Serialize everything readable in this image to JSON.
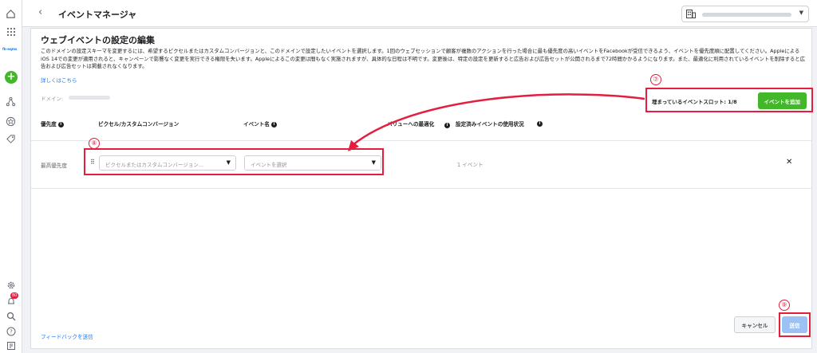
{
  "app": {
    "brand": "fb-eqms"
  },
  "header": {
    "title": "イベントマネージャ",
    "account_name": "",
    "notifications_badge": "80"
  },
  "page": {
    "title": "ウェブイベントの設定の編集",
    "description": "このドメインの設定スキーマを変更するには、希望するピクセルまたはカスタムコンバージョンと、このドメインで設定したいイベントを選択します。1回のウェブセッションで顧客が複数のアクションを行った場合に最も優先度の高いイベントをFacebookが受信できるよう、イベントを優先度順に配置してください。AppleによるiOS 14での変更が適用されると、キャンペーンで影響なく変更を実行できる権限を失います。Appleによるこの変更は間もなく実施されますが、具体的な日程は不明です。変更後は、特定の設定を更新すると広告および広告セットが公開されるまで72時間かかるようになります。また、最適化に利用されているイベントを削除すると広告および広告セットは掲載されなくなります。",
    "learn_more": "詳しくはこちら",
    "domain_label": "ドメイン:",
    "slots_text": "埋まっているイベントスロット: 1/8",
    "add_event_button": "イベントを追加",
    "annotations": {
      "n7": "⑦",
      "n8": "⑧",
      "n9": "⑨"
    }
  },
  "table": {
    "headers": {
      "priority": "優先度",
      "pixel": "ピクセル/カスタムコンバージョン",
      "event_name": "イベント名",
      "value_opt": "バリューへの最適化",
      "usage": "設定済みイベントの使用状況"
    },
    "rows": [
      {
        "priority": "最高優先度",
        "pixel_placeholder": "ピクセルまたはカスタムコンバージョン...",
        "event_placeholder": "イベントを選択",
        "usage": "1 イベント"
      }
    ]
  },
  "footer": {
    "feedback": "フィードバックを送信",
    "cancel": "キャンセル",
    "send": "送信"
  },
  "colors": {
    "accent": "#1877f2",
    "add_green": "#42b72a",
    "highlight_red": "#e41e3f",
    "disabled_blue": "#9cc2f5"
  }
}
